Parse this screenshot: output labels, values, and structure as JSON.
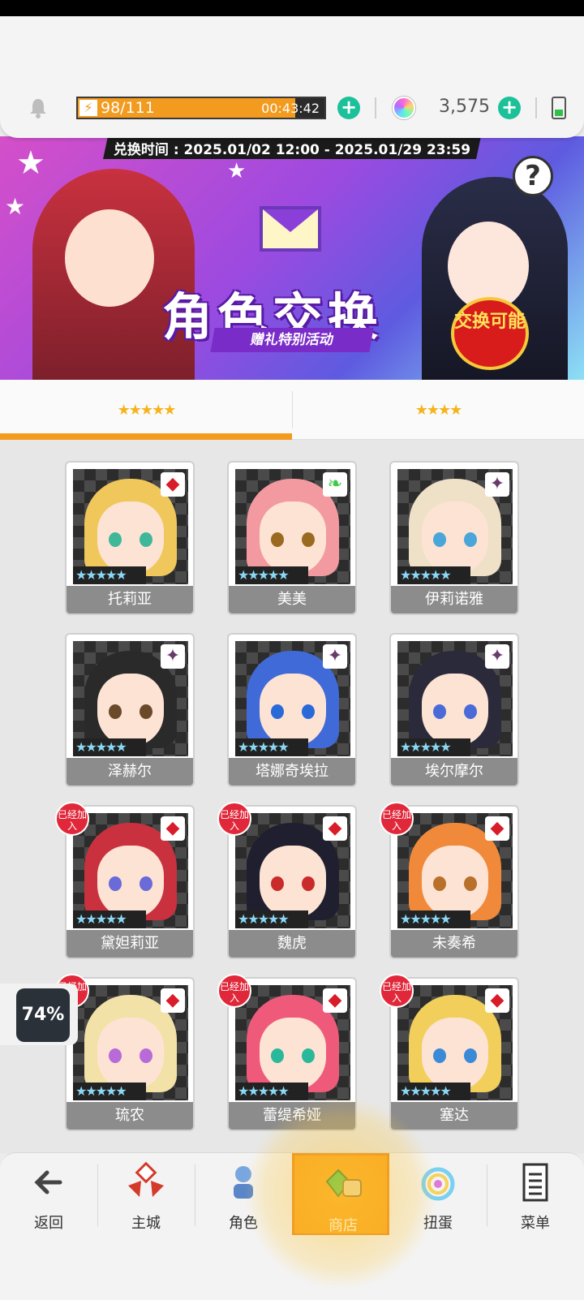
{
  "hud": {
    "energy": "98/111",
    "energy_fraction": 0.88,
    "energy_timer": "00:43:42",
    "gems": "3,575"
  },
  "banner": {
    "time": "兑换时间 : 2025.01/02 12:00 - 2025.01/29 23:59",
    "title": "角色交换",
    "subtitle": "赠礼特别活动",
    "stamp": "交换可能",
    "help": "?"
  },
  "tabs": [
    {
      "label": "★★★★★",
      "active": true
    },
    {
      "label": "★★★★",
      "active": false
    }
  ],
  "cards": [
    {
      "name": "托莉亚",
      "joined": false,
      "element": "◆",
      "hair": "#f0c75a",
      "eye": "#3fb89a"
    },
    {
      "name": "美美",
      "joined": false,
      "element": "❧",
      "hair": "#f29aa0",
      "eye": "#9a6a20"
    },
    {
      "name": "伊莉诺雅",
      "joined": false,
      "element": "✦",
      "hair": "#efe0c8",
      "eye": "#4aa6d8"
    },
    {
      "name": "泽赫尔",
      "joined": false,
      "element": "✦",
      "hair": "#2a2a2a",
      "eye": "#6a4a2a"
    },
    {
      "name": "塔娜奇埃拉",
      "joined": false,
      "element": "✦",
      "hair": "#3f6ad8",
      "eye": "#2a6ad8"
    },
    {
      "name": "埃尔摩尔",
      "joined": false,
      "element": "✦",
      "hair": "#2a2a3a",
      "eye": "#4a6ad8"
    },
    {
      "name": "黛妲莉亚",
      "joined": true,
      "element": "◆",
      "hair": "#c9313f",
      "eye": "#6a6ad8"
    },
    {
      "name": "魏虎",
      "joined": true,
      "element": "◆",
      "hair": "#1f1f2f",
      "eye": "#c92a2a"
    },
    {
      "name": "未奏希",
      "joined": true,
      "element": "◆",
      "hair": "#f08a3a",
      "eye": "#b8702a"
    },
    {
      "name": "琉农",
      "joined": true,
      "element": "◆",
      "hair": "#f2e2a8",
      "eye": "#b86ad8"
    },
    {
      "name": "蕾缇希娅",
      "joined": true,
      "element": "◆",
      "hair": "#ef5a7a",
      "eye": "#2ab89a"
    },
    {
      "name": "塞达",
      "joined": true,
      "element": "◆",
      "hair": "#f2cf5a",
      "eye": "#3a8ad8"
    }
  ],
  "rarity_label": "★★★★★",
  "joined_label": "已经加入",
  "progress_badge": "74%",
  "nav": [
    {
      "label": "返回",
      "icon": "back-arrow-icon"
    },
    {
      "label": "主城",
      "icon": "castle-icon"
    },
    {
      "label": "角色",
      "icon": "character-icon"
    },
    {
      "label": "商店",
      "icon": "shop-icon"
    },
    {
      "label": "扭蛋",
      "icon": "gacha-icon"
    },
    {
      "label": "菜单",
      "icon": "menu-icon"
    }
  ]
}
